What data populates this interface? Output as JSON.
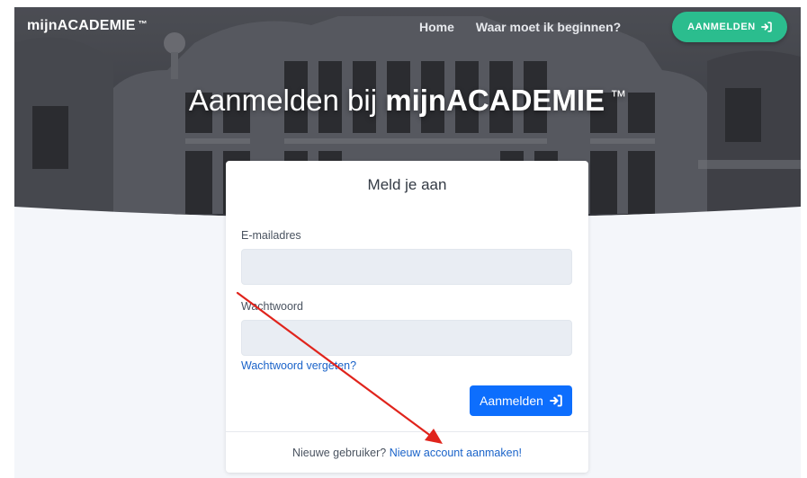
{
  "header": {
    "brand": "mijnACADEMIE",
    "brand_tm": "™",
    "nav": [
      {
        "label": "Home"
      },
      {
        "label": "Waar moet ik beginnen?"
      }
    ],
    "login_button": "AANMELDEN"
  },
  "hero": {
    "title_prefix": "Aanmelden bij",
    "title_brand": "mijnACADEMIE",
    "title_tm": "™"
  },
  "login_form": {
    "title": "Meld je aan",
    "email_label": "E-mailadres",
    "email_value": "",
    "password_label": "Wachtwoord",
    "password_value": "",
    "forgot_link": "Wachtwoord vergeten?",
    "submit_label": "Aanmelden",
    "new_user_text": "Nieuwe gebruiker?",
    "new_account_link": "Nieuw account aanmaken!"
  },
  "colors": {
    "accent_green": "#2bbd8e",
    "primary_blue": "#0d6efd",
    "link_blue": "#1a63c9",
    "annotation_red": "#e0241c"
  },
  "icons": {
    "login": "sign-in-icon"
  }
}
